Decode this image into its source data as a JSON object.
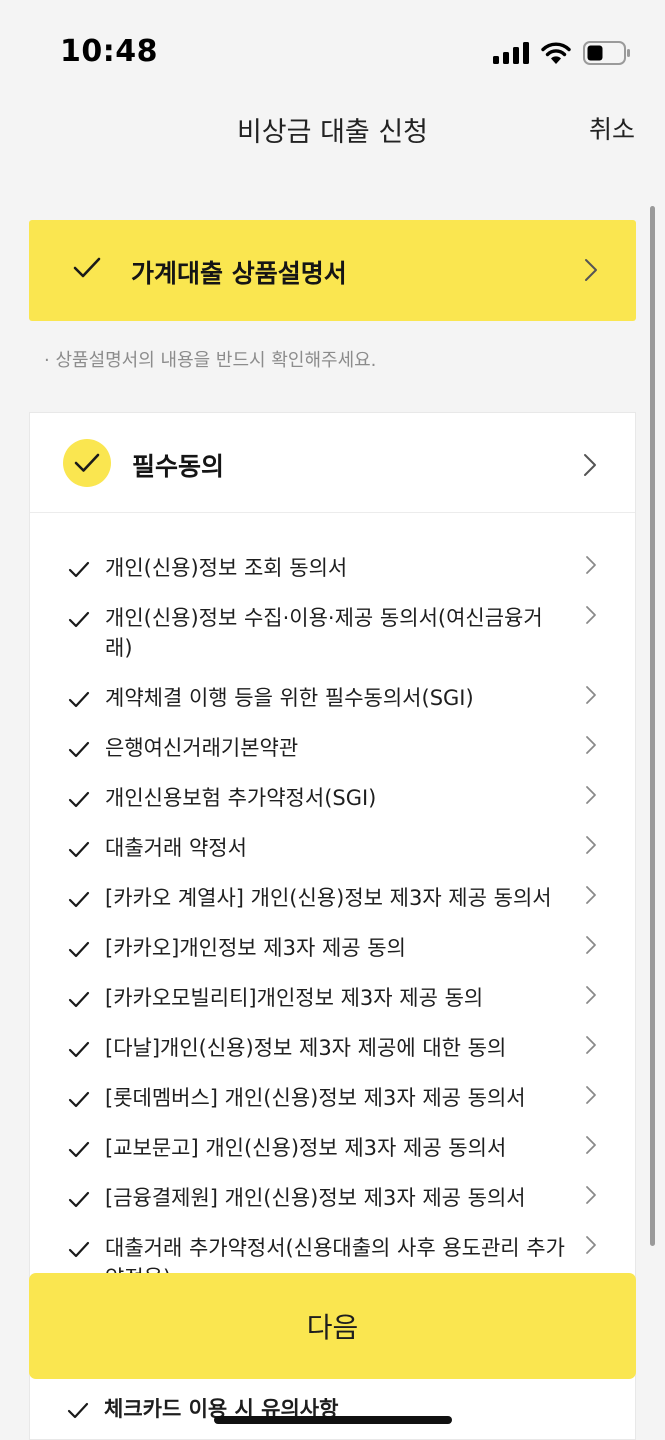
{
  "status": {
    "time": "10:48"
  },
  "header": {
    "title": "비상금 대출 신청",
    "cancel": "취소"
  },
  "product": {
    "label": "가계대출 상품설명서"
  },
  "notice": "· 상품설명서의 내용을 반드시 확인해주세요.",
  "consent": {
    "label": "필수동의",
    "items": [
      "개인(신용)정보 조회 동의서",
      "개인(신용)정보 수집·이용·제공 동의서(여신금융거래)",
      "계약체결 이행 등을 위한 필수동의서(SGI)",
      "은행여신거래기본약관",
      "개인신용보험 추가약정서(SGI)",
      "대출거래 약정서",
      "[카카오 계열사] 개인(신용)정보 제3자 제공 동의서",
      "[카카오]개인정보 제3자 제공 동의",
      "[카카오모빌리티]개인정보 제3자 제공 동의",
      "[다날]개인(신용)정보 제3자 제공에 대한 동의",
      "[롯데멤버스] 개인(신용)정보 제3자 제공 동의서",
      "[교보문고] 개인(신용)정보 제3자 제공 동의서",
      "[금융결제원] 개인(신용)정보 제3자 제공 동의서",
      "대출거래 추가약정서(신용대출의 사후 용도관리 추가약정용)"
    ]
  },
  "next_button": "다음",
  "below_item": "체크카드 이용 시 유의사항",
  "colors": {
    "accent": "#fae650",
    "text": "#1e1e1e",
    "muted": "#8c8c8c"
  }
}
